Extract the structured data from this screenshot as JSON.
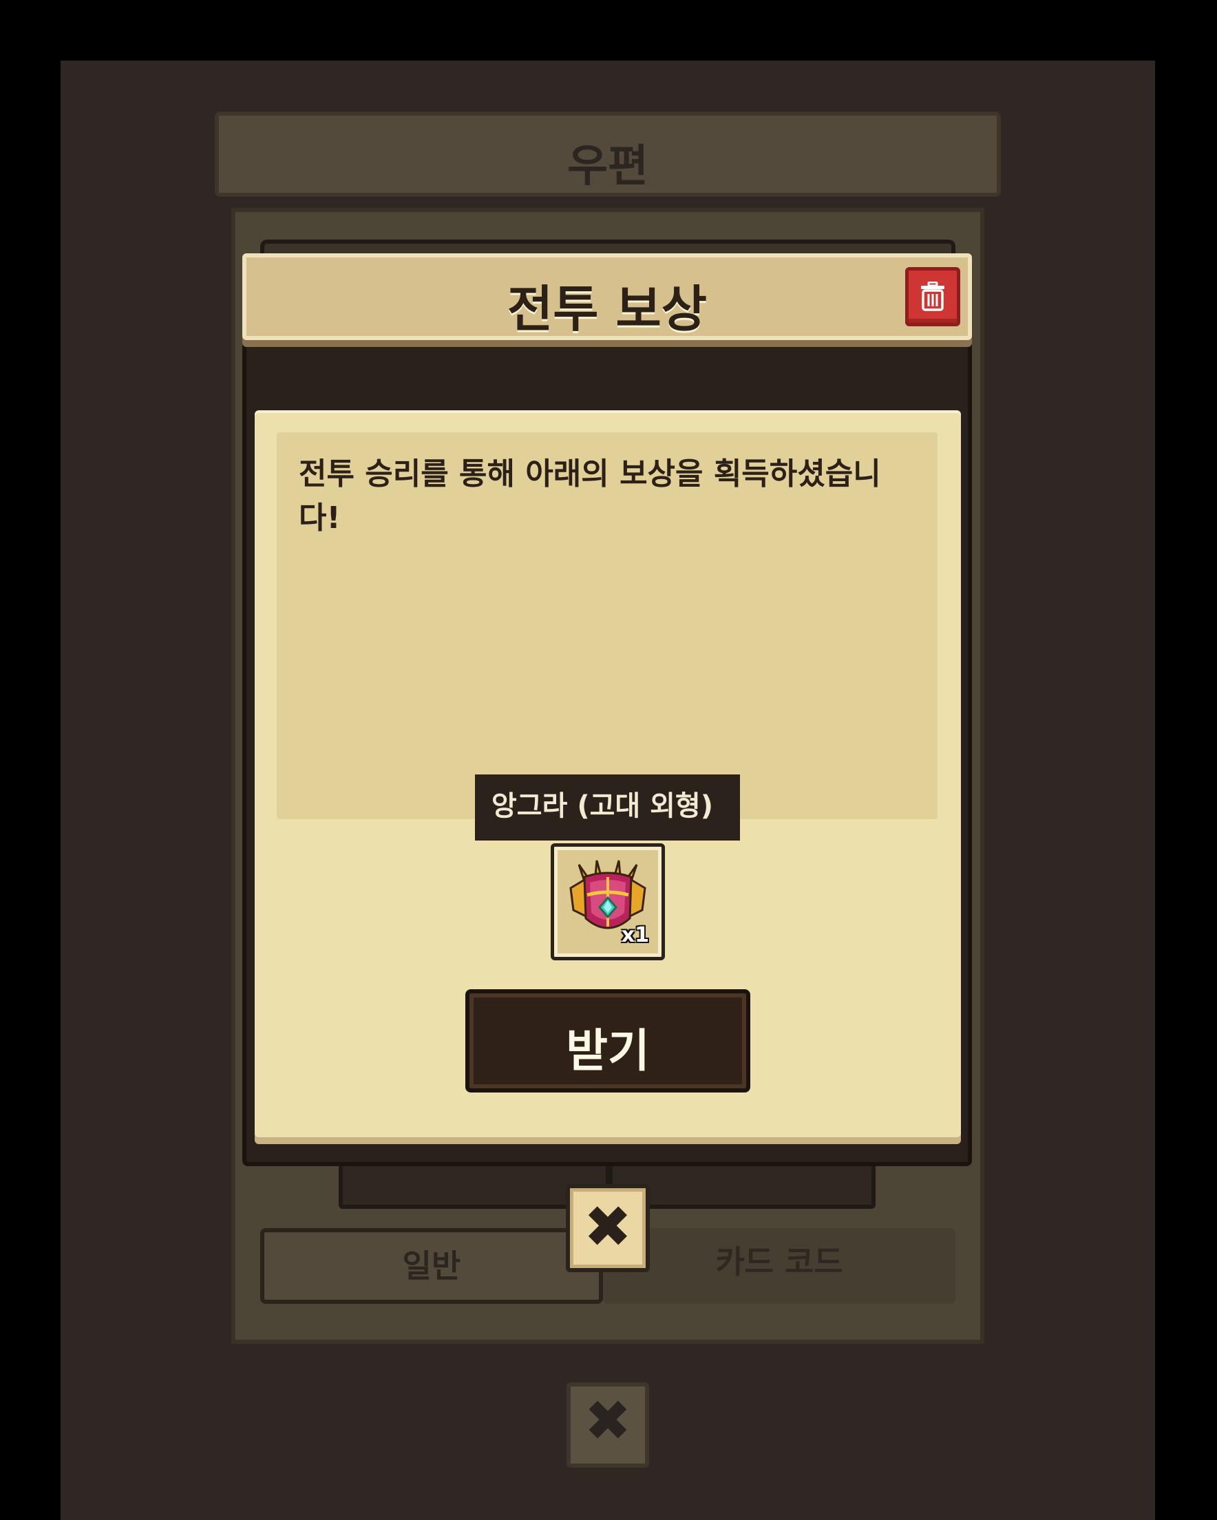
{
  "background_window": {
    "title": "우편",
    "tabs": [
      {
        "label": "일반",
        "selected": true
      },
      {
        "label": "카드 코드",
        "selected": false
      }
    ],
    "close_icon": "close-x-icon"
  },
  "popup": {
    "title": "전투 보상",
    "delete_icon": "trash-icon",
    "message": "전투 승리를 통해 아래의 보상을 획득하셨습니다!",
    "reward": {
      "tooltip": "앙그라 (고대 외형)",
      "quantity": "x1",
      "icon": "ornate-armor-icon"
    },
    "receive_label": "받기",
    "close_icon": "close-x-icon"
  },
  "colors": {
    "header_tan": "#d6c08d",
    "panel_cream": "#ece0ad",
    "dark_brown": "#2b211b",
    "delete_red": "#cf3532"
  }
}
